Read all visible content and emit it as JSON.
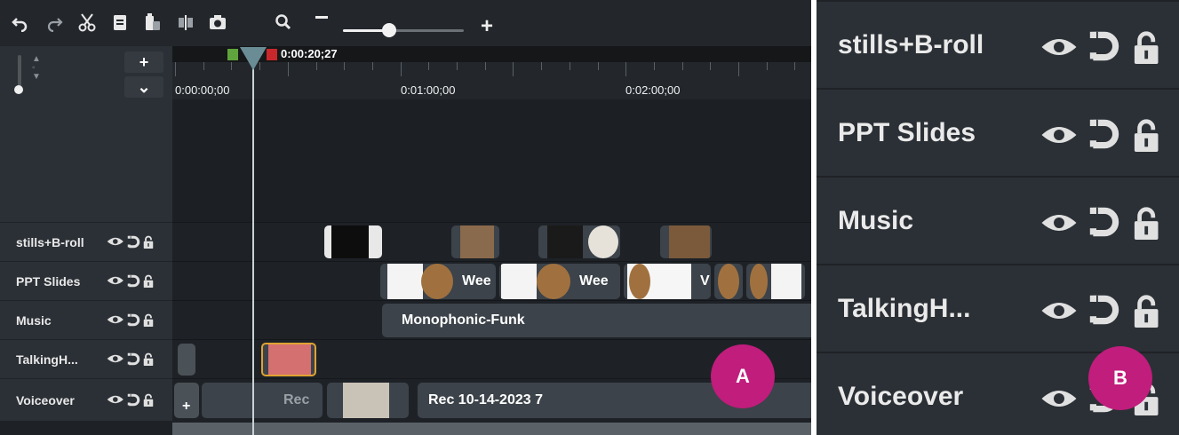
{
  "toolbar": {
    "icons": [
      "undo-icon",
      "redo-icon",
      "cut-icon",
      "copy-icon",
      "paste-icon",
      "split-icon",
      "snapshot-icon",
      "zoom-search-icon"
    ],
    "zoom_level": 0.38
  },
  "track_controls": {
    "add_label": "+",
    "expand_label": "⌄"
  },
  "ruler": {
    "playhead_time": "0:00:20;27",
    "time_labels": [
      "0:00:00;00",
      "0:01:00;00",
      "0:02:00;00"
    ]
  },
  "tracks": [
    {
      "name": "stills+B-roll"
    },
    {
      "name": "PPT Slides"
    },
    {
      "name": "Music"
    },
    {
      "name": "TalkingH..."
    },
    {
      "name": "Voiceover"
    }
  ],
  "clips": {
    "ppt_1_label": "Wee",
    "ppt_2_label": "Wee",
    "ppt_3_label": "V",
    "music_label": "Monophonic-Funk",
    "voice_1_label": "Rec",
    "voice_2_label": "Rec 10-14-2023 7",
    "voice_add_label": "+"
  },
  "callouts": {
    "a": "A",
    "b": "B"
  },
  "panel_b_tracks": [
    {
      "name": "stills+B-roll"
    },
    {
      "name": "PPT Slides"
    },
    {
      "name": "Music"
    },
    {
      "name": "TalkingH..."
    },
    {
      "name": "Voiceover"
    }
  ],
  "colors": {
    "timeline_bg": "#1e2227",
    "header_bg": "#2b3036",
    "callout": "#c01d7c",
    "playhead": "#6a8d95",
    "clip_bg": "#3c434a"
  }
}
